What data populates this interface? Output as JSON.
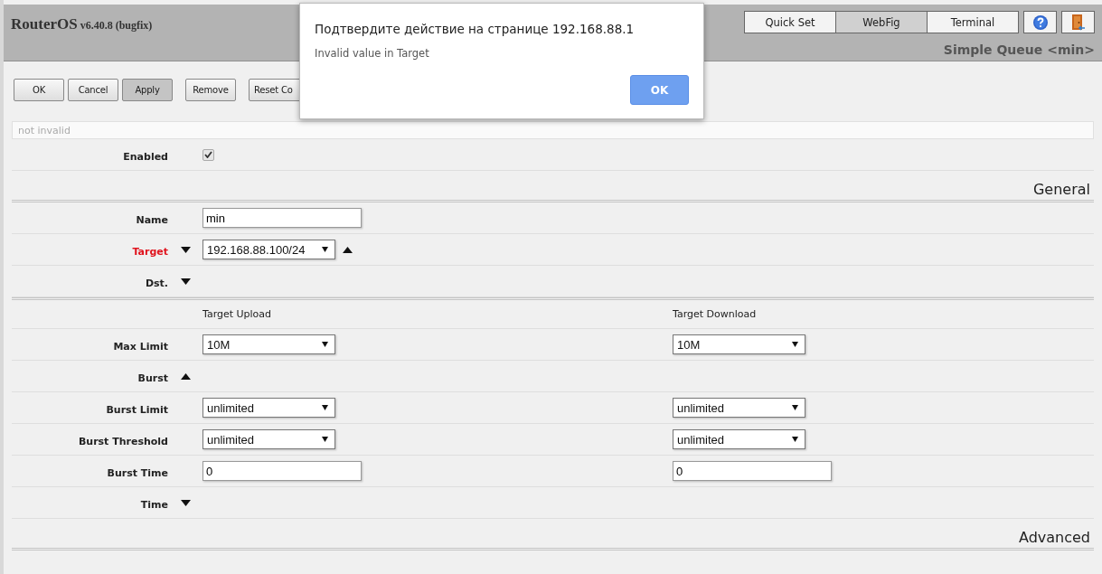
{
  "header": {
    "product": "RouterOS",
    "version": "v6.40.8 (bugfix)",
    "tabs": [
      {
        "label": "Quick Set",
        "selected": false
      },
      {
        "label": "WebFig",
        "selected": true
      },
      {
        "label": "Terminal",
        "selected": false
      }
    ],
    "page_title": "Simple Queue <min>"
  },
  "toolbar": [
    {
      "label": "OK",
      "pressed": false
    },
    {
      "label": "Cancel",
      "pressed": false
    },
    {
      "label": "Apply",
      "pressed": true
    },
    {
      "label": "Remove",
      "pressed": false
    },
    {
      "label": "Reset Co",
      "pressed": false
    }
  ],
  "status_field": {
    "value": "not invalid"
  },
  "rows": [
    {
      "kind": "checkbox",
      "label": "Enabled",
      "checked": true
    },
    {
      "kind": "section",
      "label": "General"
    },
    {
      "kind": "text",
      "label": "Name",
      "values": [
        "min"
      ]
    },
    {
      "kind": "select",
      "label": "Target",
      "error": true,
      "expanded": false,
      "up_button": true,
      "values": [
        "192.168.88.100/24"
      ]
    },
    {
      "kind": "toggle",
      "label": "Dst.",
      "expanded": false
    },
    {
      "kind": "columns",
      "headings": [
        "Target Upload",
        "Target Download"
      ]
    },
    {
      "kind": "select",
      "label": "Max Limit",
      "values": [
        "10M",
        "10M"
      ]
    },
    {
      "kind": "toggle",
      "label": "Burst",
      "expanded": true
    },
    {
      "kind": "select",
      "label": "Burst Limit",
      "values": [
        "unlimited",
        "unlimited"
      ]
    },
    {
      "kind": "select",
      "label": "Burst Threshold",
      "values": [
        "unlimited",
        "unlimited"
      ]
    },
    {
      "kind": "text",
      "label": "Burst Time",
      "values": [
        "0",
        "0"
      ]
    },
    {
      "kind": "toggle",
      "label": "Time",
      "expanded": false
    },
    {
      "kind": "section",
      "label": "Advanced"
    }
  ],
  "dialog": {
    "title": "Подтвердите действие на странице 192.168.88.1",
    "message": "Invalid value in Target",
    "button": "OK"
  }
}
